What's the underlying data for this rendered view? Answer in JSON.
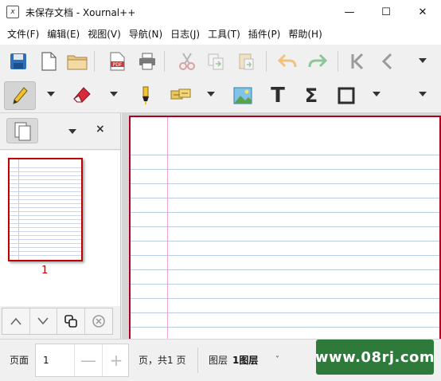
{
  "window": {
    "title": "未保存文档 - Xournal++",
    "app_icon": "xournal-app-icon",
    "controls": {
      "minimize": "—",
      "maximize": "☐",
      "close": "✕"
    }
  },
  "menu": [
    {
      "label": "文件(F)"
    },
    {
      "label": "编辑(E)"
    },
    {
      "label": "视图(V)"
    },
    {
      "label": "导航(N)"
    },
    {
      "label": "日志(J)"
    },
    {
      "label": "工具(T)"
    },
    {
      "label": "插件(P)"
    },
    {
      "label": "帮助(H)"
    }
  ],
  "toolbar1": {
    "icons": [
      "save-icon",
      "new-document-icon",
      "open-folder-icon",
      "export-pdf-icon",
      "print-icon",
      "cut-icon",
      "copy-icon",
      "paste-icon",
      "undo-icon",
      "redo-icon",
      "first-page-icon",
      "previous-page-icon",
      "more-dropdown-icon"
    ],
    "pdf_label": "PDF"
  },
  "toolbar2": {
    "icons": [
      "pen-icon",
      "eraser-icon",
      "highlighter-icon",
      "text-stamp-icon",
      "image-icon",
      "text-icon",
      "math-tex-icon",
      "rectangle-icon",
      "more-dropdown-icon"
    ],
    "text_glyph": "T",
    "math_glyph": "Σ"
  },
  "sidebar": {
    "close_label": "×",
    "page_number": "1",
    "nav_icons": [
      "move-page-up-icon",
      "move-page-down-icon",
      "copy-page-icon",
      "delete-page-icon"
    ]
  },
  "statusbar": {
    "page_label": "页面",
    "page_value": "1",
    "decrement": "—",
    "increment": "+",
    "page_total": "页，共1 页",
    "layer_label": "图层",
    "layer_value": "1图层",
    "layer_arrow": "˅",
    "watermark": "www.08rj.com"
  },
  "colors": {
    "accent_red": "#c00000",
    "rule_blue": "#b9cce8",
    "margin_pink": "#f2a6cf",
    "watermark_green": "#2e7a3a"
  }
}
